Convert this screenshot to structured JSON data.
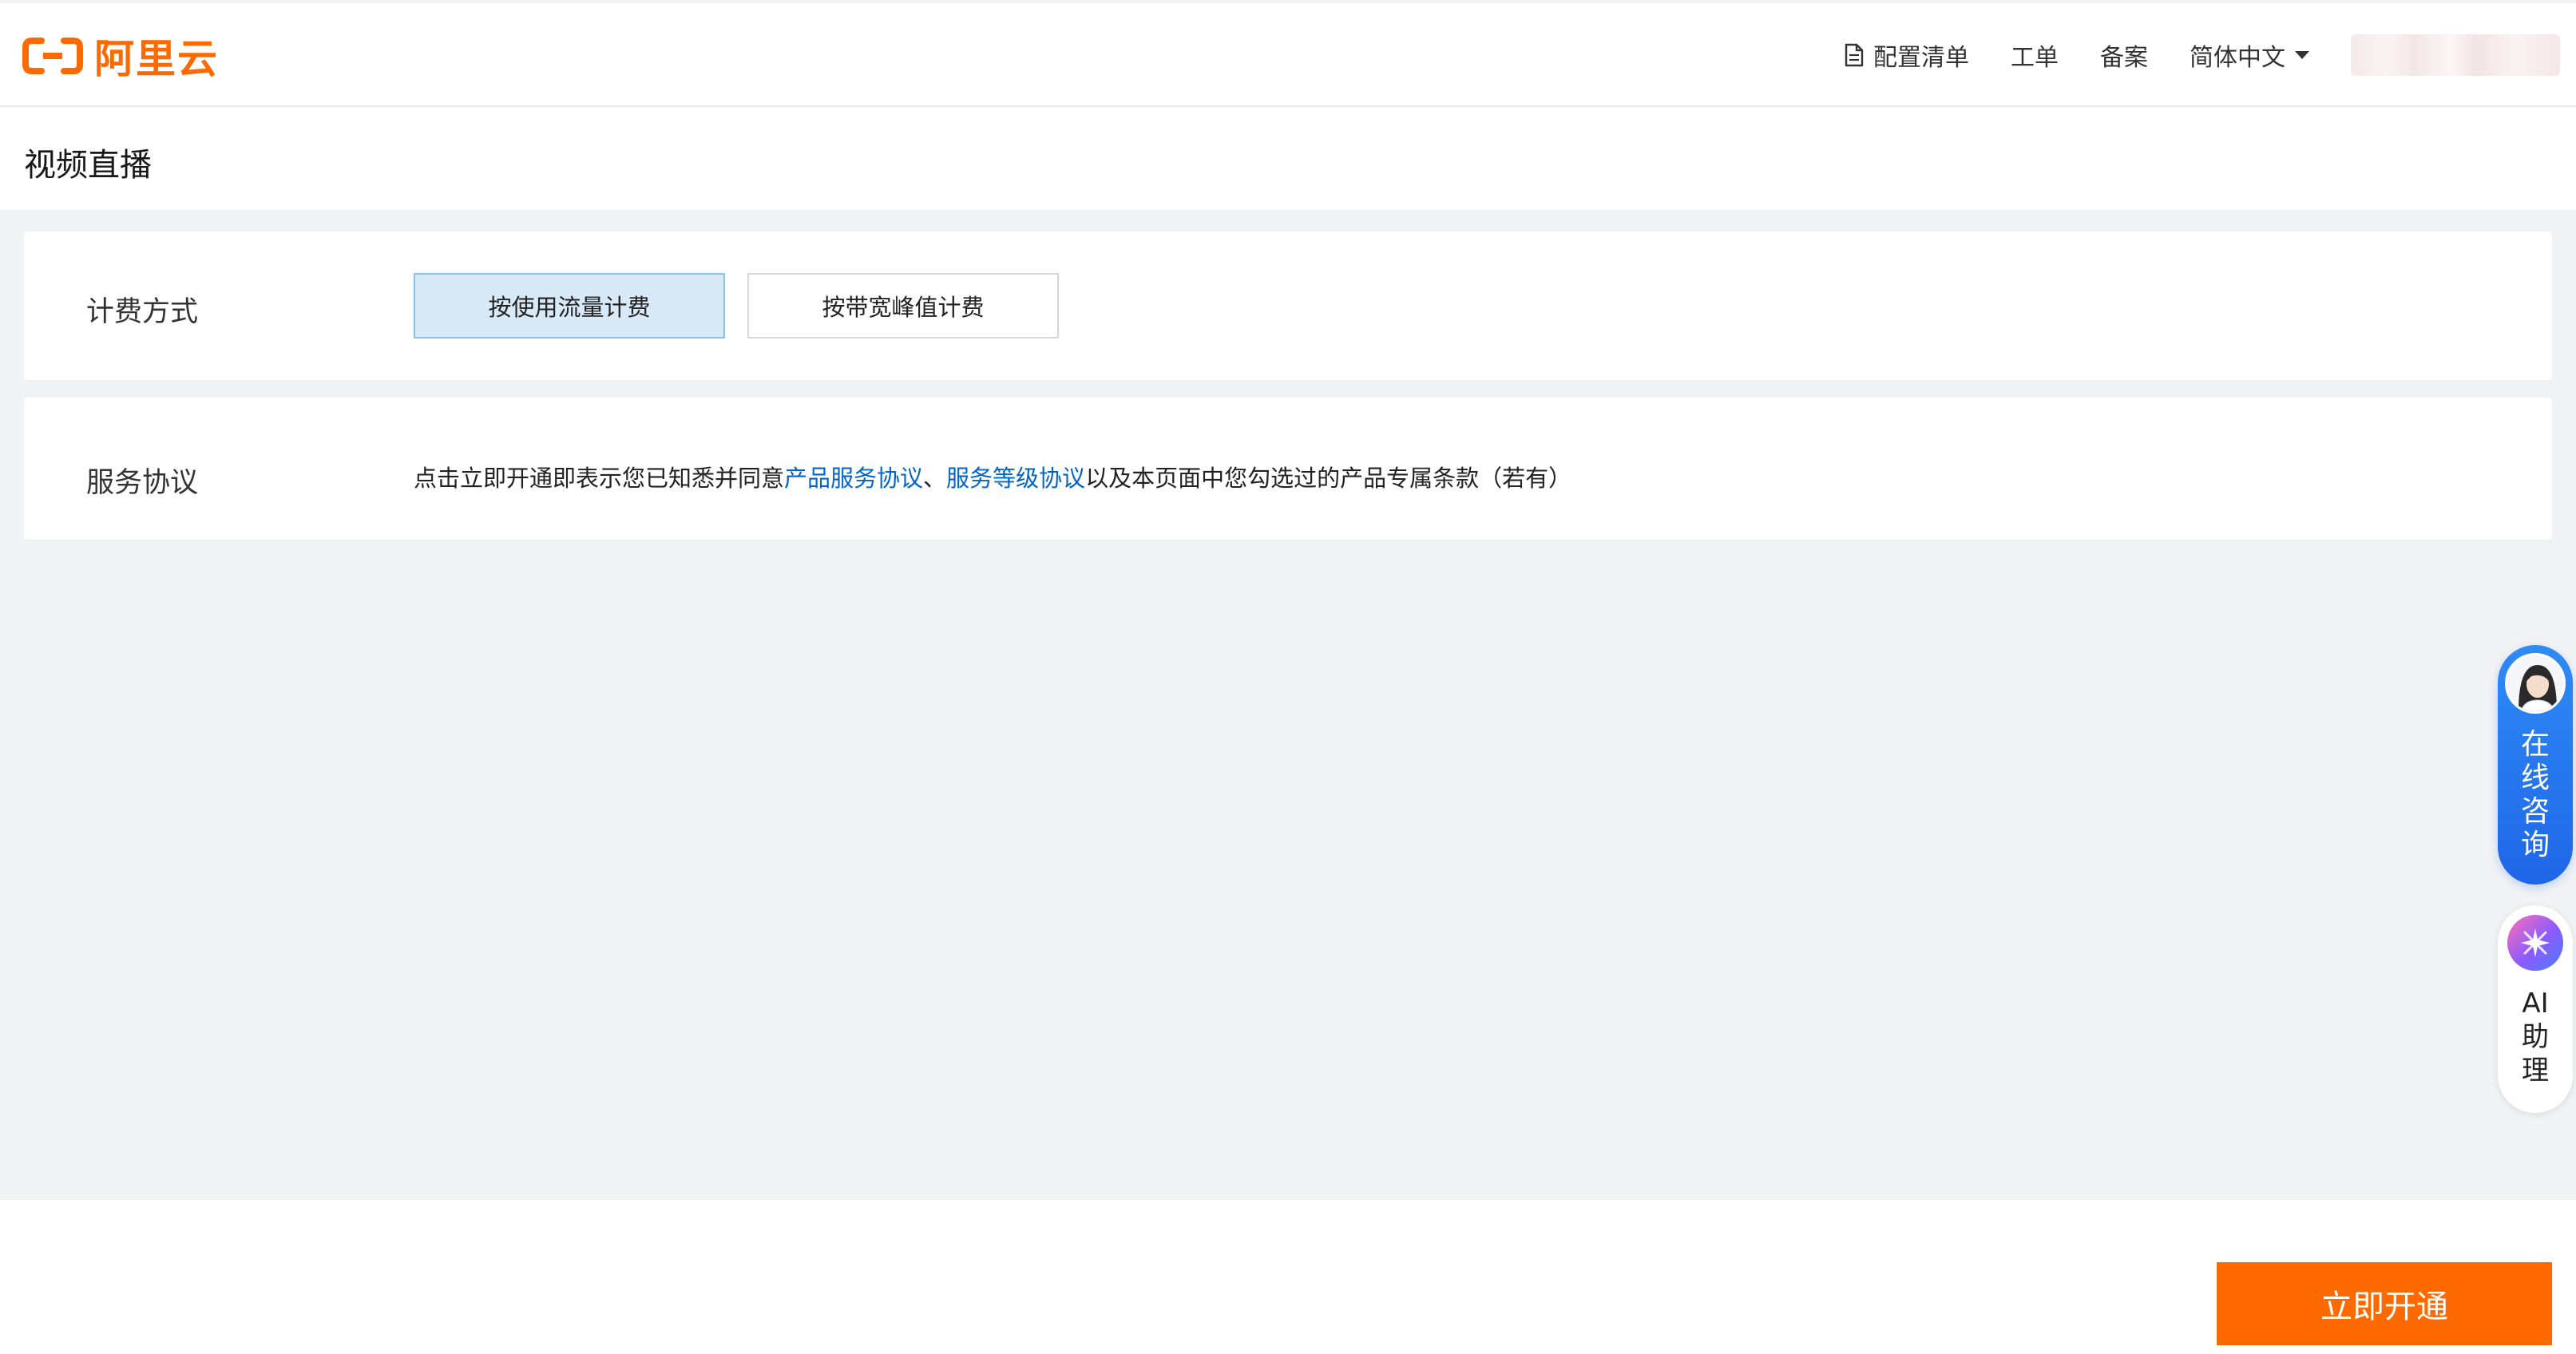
{
  "header": {
    "logo_text": "阿里云",
    "nav": {
      "config_list": "配置清单",
      "ticket": "工单",
      "filing": "备案",
      "language": "简体中文"
    }
  },
  "page": {
    "title": "视频直播"
  },
  "billing": {
    "label": "计费方式",
    "options": [
      {
        "label": "按使用流量计费",
        "selected": true
      },
      {
        "label": "按带宽峰值计费",
        "selected": false
      }
    ]
  },
  "agreement": {
    "label": "服务协议",
    "text_prefix": "点击立即开通即表示您已知悉并同意",
    "link1": "产品服务协议",
    "separator": "、",
    "link2": "服务等级协议",
    "text_suffix": "以及本页面中您勾选过的产品专属条款（若有）"
  },
  "footer": {
    "cta_label": "立即开通"
  },
  "floating": {
    "consult_label": "在线咨询",
    "ai_label": "AI助理"
  },
  "colors": {
    "brand": "#ff6a00",
    "link": "#0064c8",
    "selected_bg": "#d8e9f8",
    "consult_blue": "#1f66e8"
  }
}
